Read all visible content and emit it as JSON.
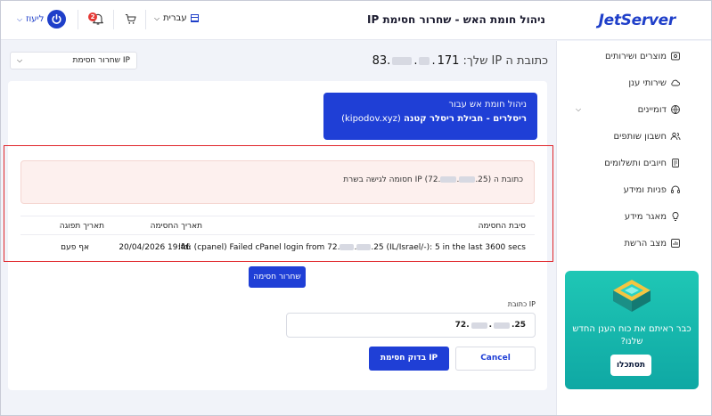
{
  "header": {
    "logo": "JetServer",
    "title": "ניהול חומת האש - שחרור חסימת IP",
    "user_name": "ליעוז",
    "notifications_count": "2",
    "language": "עברית"
  },
  "sidebar": {
    "items": [
      {
        "label": "מוצרים ושירותים",
        "icon": "box-icon"
      },
      {
        "label": "שירותי ענן",
        "icon": "cloud-icon"
      },
      {
        "label": "דומיינים",
        "icon": "globe-icon",
        "expandable": true
      },
      {
        "label": "חשבון שותפים",
        "icon": "users-icon"
      },
      {
        "label": "חיובים ותשלומים",
        "icon": "invoice-icon"
      },
      {
        "label": "פניות ומידע",
        "icon": "headset-icon"
      },
      {
        "label": "מאגר מידע",
        "icon": "lightbulb-icon"
      },
      {
        "label": "מצב הרשת",
        "icon": "chart-icon"
      }
    ],
    "promo": {
      "text": "כבר ראיתם את כוח הענן החדש שלנו?",
      "button": "תסתכלו"
    }
  },
  "main": {
    "ip_label": "כתובת ה IP שלך:",
    "ip_start": "83.",
    "ip_mid": "171",
    "select_value": "שחרור חסימת IP",
    "fw_box": {
      "line1": "ניהול חומת אש עבור",
      "line2_bold": "ריסלרים - חבילת ריסלר קטנה",
      "line2_domain": "(kipodov.xyz)"
    },
    "alert_prefix": "כתובת ה IP (72.",
    "alert_suffix": ".25) חסומה לגישה בשרת",
    "table": {
      "headers": [
        "סיבת החסימה",
        "תאריך החסימה",
        "תאריך תפוגה"
      ],
      "row": {
        "reason_prefix": "lfd: (cpanel) Failed cPanel login from 72.",
        "reason_suffix": ".25 (IL/Israel/-): 5 in the last 3600 secs",
        "block_date": "20/04/2026 19:46",
        "expiry": "אף פעם"
      }
    },
    "release_button": "שחרור חסימה",
    "ip_field_label": "כתובת IP",
    "ip_field_prefix": "72.",
    "ip_field_suffix": ".25",
    "check_button": "בדוק חסימת IP",
    "cancel_button": "Cancel"
  },
  "colors": {
    "accent": "#1f3fd6",
    "alert_bg": "#fdf0ee",
    "highlight": "#e0262b",
    "promo": "#14b8ae"
  }
}
